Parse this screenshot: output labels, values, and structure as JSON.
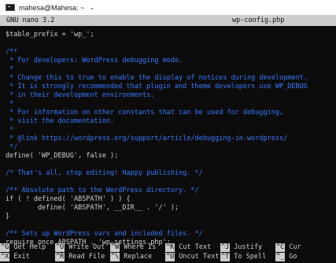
{
  "window": {
    "title": "mahesa@Mahesa: ~"
  },
  "nano": {
    "version": "GNU nano 3.2",
    "filename": "wp-config.php"
  },
  "lines": [
    {
      "text": "$table_prefix = 'wp_';",
      "kind": "plain"
    },
    {
      "text": "",
      "kind": "plain"
    },
    {
      "text": "/**",
      "kind": "comment"
    },
    {
      "text": " * For developers: WordPress debugging mode.",
      "kind": "comment"
    },
    {
      "text": " *",
      "kind": "comment"
    },
    {
      "text": " * Change this to true to enable the display of notices during development.",
      "kind": "comment"
    },
    {
      "text": " * It is strongly recommended that plugin and theme developers use WP_DEBUG",
      "kind": "comment"
    },
    {
      "text": " * in their development environments.",
      "kind": "comment"
    },
    {
      "text": " *",
      "kind": "comment"
    },
    {
      "text": " * For information on other constants that can be used for debugging,",
      "kind": "comment"
    },
    {
      "text": " * visit the documentation.",
      "kind": "comment"
    },
    {
      "text": " *",
      "kind": "comment"
    },
    {
      "text": " * @link https://wordpress.org/support/article/debugging-in-wordpress/",
      "kind": "comment"
    },
    {
      "text": " */",
      "kind": "comment"
    },
    {
      "text": "define( 'WP_DEBUG', false );",
      "kind": "plain"
    },
    {
      "text": "",
      "kind": "plain"
    },
    {
      "text": "/* That's all, stop editing! Happy publishing. */",
      "kind": "comment"
    },
    {
      "text": "",
      "kind": "plain"
    },
    {
      "text": "/** Absolute path to the WordPress directory. */",
      "kind": "comment"
    },
    {
      "text": "if ( ! defined( 'ABSPATH' ) ) {",
      "kind": "plain"
    },
    {
      "text": "        define( 'ABSPATH', __DIR__ . '/' );",
      "kind": "plain"
    },
    {
      "text": "}",
      "kind": "plain"
    },
    {
      "text": "",
      "kind": "plain"
    },
    {
      "text": "/** Sets up WordPress vars and included files. */",
      "kind": "comment"
    },
    {
      "text": "require_once ABSPATH . 'wp-settings.php';",
      "kind": "plain"
    }
  ],
  "shortcuts": [
    {
      "key": "^G",
      "label": "Get Help"
    },
    {
      "key": "^O",
      "label": "Write Out"
    },
    {
      "key": "^W",
      "label": "Where Is"
    },
    {
      "key": "^K",
      "label": "Cut Text"
    },
    {
      "key": "^J",
      "label": "Justify"
    },
    {
      "key": "^C",
      "label": "Cur"
    },
    {
      "key": "^X",
      "label": "Exit"
    },
    {
      "key": "^R",
      "label": "Read File"
    },
    {
      "key": "^\\",
      "label": "Replace"
    },
    {
      "key": "^U",
      "label": "Uncut Text"
    },
    {
      "key": "^T",
      "label": "To Spell"
    },
    {
      "key": "^_",
      "label": "Go"
    }
  ]
}
